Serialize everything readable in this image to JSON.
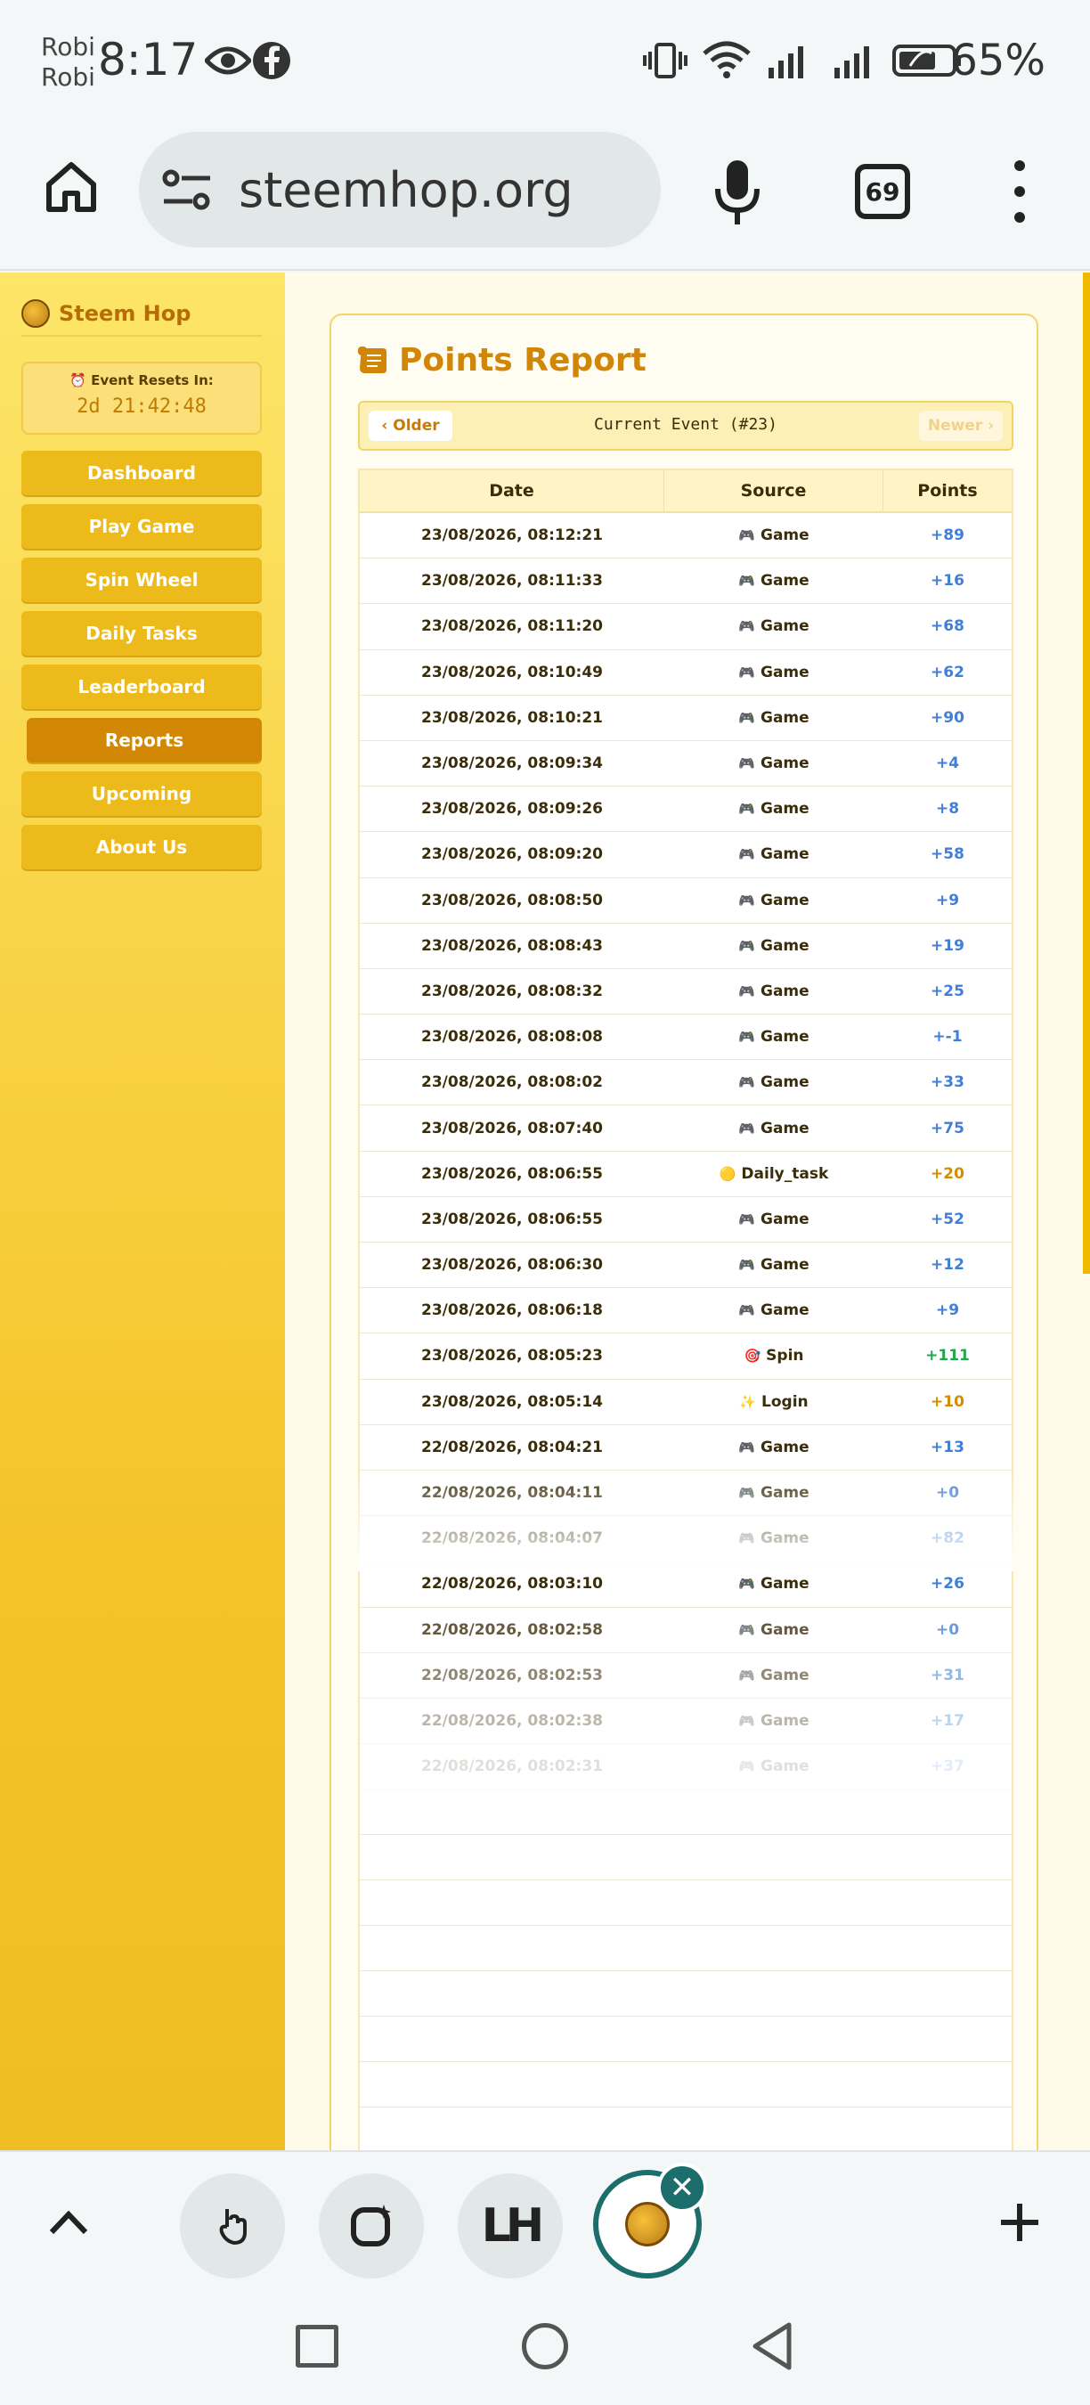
{
  "status_bar": {
    "carrier_line1": "Robi",
    "carrier_line2": "Robi",
    "time": "8:17",
    "battery": "65%"
  },
  "browser": {
    "url": "steemhop.org",
    "tab_count": "69"
  },
  "sidebar": {
    "brand": "Steem Hop",
    "event_label": "⏰ Event Resets In:",
    "event_timer": "2d 21:42:48",
    "items": [
      {
        "label": "Dashboard",
        "active": false
      },
      {
        "label": "Play Game",
        "active": false
      },
      {
        "label": "Spin Wheel",
        "active": false
      },
      {
        "label": "Daily Tasks",
        "active": false
      },
      {
        "label": "Leaderboard",
        "active": false
      },
      {
        "label": "Reports",
        "active": true
      },
      {
        "label": "Upcoming",
        "active": false
      },
      {
        "label": "About Us",
        "active": false
      }
    ]
  },
  "report": {
    "title": "Points Report",
    "older_label": "‹ Older",
    "newer_label": "Newer ›",
    "current_event": "Current Event (#23)",
    "columns": [
      "Date",
      "Source",
      "Points"
    ],
    "rows": [
      {
        "date": "23/08/2026, 08:12:21",
        "icon": "🎮",
        "source": "Game",
        "points": "+89",
        "color": "#3f7fd8"
      },
      {
        "date": "23/08/2026, 08:11:33",
        "icon": "🎮",
        "source": "Game",
        "points": "+16",
        "color": "#3f7fd8"
      },
      {
        "date": "23/08/2026, 08:11:20",
        "icon": "🎮",
        "source": "Game",
        "points": "+68",
        "color": "#3f7fd8"
      },
      {
        "date": "23/08/2026, 08:10:49",
        "icon": "🎮",
        "source": "Game",
        "points": "+62",
        "color": "#3f7fd8"
      },
      {
        "date": "23/08/2026, 08:10:21",
        "icon": "🎮",
        "source": "Game",
        "points": "+90",
        "color": "#3f7fd8"
      },
      {
        "date": "23/08/2026, 08:09:34",
        "icon": "🎮",
        "source": "Game",
        "points": "+4",
        "color": "#3f7fd8"
      },
      {
        "date": "23/08/2026, 08:09:26",
        "icon": "🎮",
        "source": "Game",
        "points": "+8",
        "color": "#3f7fd8"
      },
      {
        "date": "23/08/2026, 08:09:20",
        "icon": "🎮",
        "source": "Game",
        "points": "+58",
        "color": "#3f7fd8"
      },
      {
        "date": "23/08/2026, 08:08:50",
        "icon": "🎮",
        "source": "Game",
        "points": "+9",
        "color": "#3f7fd8"
      },
      {
        "date": "23/08/2026, 08:08:43",
        "icon": "🎮",
        "source": "Game",
        "points": "+19",
        "color": "#3f7fd8"
      },
      {
        "date": "23/08/2026, 08:08:32",
        "icon": "🎮",
        "source": "Game",
        "points": "+25",
        "color": "#3f7fd8"
      },
      {
        "date": "23/08/2026, 08:08:08",
        "icon": "🎮",
        "source": "Game",
        "points": "+-1",
        "color": "#3f7fd8"
      },
      {
        "date": "23/08/2026, 08:08:02",
        "icon": "🎮",
        "source": "Game",
        "points": "+33",
        "color": "#3f7fd8"
      },
      {
        "date": "23/08/2026, 08:07:40",
        "icon": "🎮",
        "source": "Game",
        "points": "+75",
        "color": "#3f7fd8"
      },
      {
        "date": "23/08/2026, 08:06:55",
        "icon": "🟡",
        "source": "Daily_task",
        "points": "+20",
        "color": "#d88a00"
      },
      {
        "date": "23/08/2026, 08:06:55",
        "icon": "🎮",
        "source": "Game",
        "points": "+52",
        "color": "#3f7fd8"
      },
      {
        "date": "23/08/2026, 08:06:30",
        "icon": "🎮",
        "source": "Game",
        "points": "+12",
        "color": "#3f7fd8"
      },
      {
        "date": "23/08/2026, 08:06:18",
        "icon": "🎮",
        "source": "Game",
        "points": "+9",
        "color": "#3f7fd8"
      },
      {
        "date": "23/08/2026, 08:05:23",
        "icon": "🎯",
        "source": "Spin",
        "points": "+111",
        "color": "#1ea84b"
      },
      {
        "date": "23/08/2026, 08:05:14",
        "icon": "✨",
        "source": "Login",
        "points": "+10",
        "color": "#d88a00"
      },
      {
        "date": "22/08/2026, 08:04:21",
        "icon": "🎮",
        "source": "Game",
        "points": "+13",
        "color": "#3f7fd8"
      },
      {
        "date": "22/08/2026, 08:04:11",
        "icon": "🎮",
        "source": "Game",
        "points": "+0",
        "color": "#3f7fd8"
      },
      {
        "date": "22/08/2026, 08:04:07",
        "icon": "🎮",
        "source": "Game",
        "points": "+82",
        "color": "#3f7fd8"
      },
      {
        "date": "22/08/2026, 08:03:10",
        "icon": "🎮",
        "source": "Game",
        "points": "+26",
        "color": "#3f7fd8"
      },
      {
        "date": "22/08/2026, 08:02:58",
        "icon": "🎮",
        "source": "Game",
        "points": "+0",
        "color": "#3f7fd8"
      },
      {
        "date": "22/08/2026, 08:02:53",
        "icon": "🎮",
        "source": "Game",
        "points": "+31",
        "color": "#3f7fd8"
      },
      {
        "date": "22/08/2026, 08:02:38",
        "icon": "🎮",
        "source": "Game",
        "points": "+17",
        "color": "#3f7fd8"
      },
      {
        "date": "22/08/2026, 08:02:31",
        "icon": "🎮",
        "source": "Game",
        "points": "+37",
        "color": "#3f7fd8"
      }
    ]
  },
  "tabstrip": {
    "tab3_label": "LH"
  }
}
